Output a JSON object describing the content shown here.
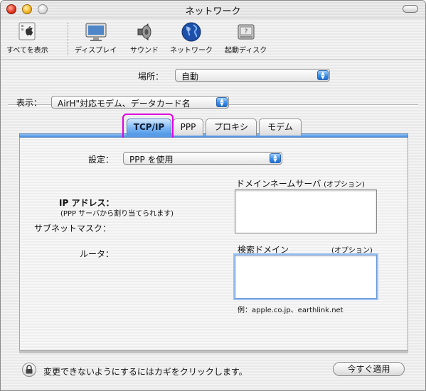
{
  "window": {
    "title": "ネットワーク"
  },
  "toolbar": {
    "items": [
      {
        "label": "すべてを表示",
        "icon": "apple-icon"
      },
      {
        "label": "ディスプレイ",
        "icon": "display-icon"
      },
      {
        "label": "サウンド",
        "icon": "speaker-icon"
      },
      {
        "label": "ネットワーク",
        "icon": "globe-icon"
      },
      {
        "label": "起動ディスク",
        "icon": "disk-icon"
      }
    ]
  },
  "location": {
    "label": "場所：",
    "value": "自動"
  },
  "show": {
    "label": "表示：",
    "value": "AirH\"対応モデム、データカード名"
  },
  "tabs": [
    {
      "label": "TCP/IP",
      "active": true
    },
    {
      "label": "PPP",
      "active": false
    },
    {
      "label": "プロキシ",
      "active": false
    },
    {
      "label": "モデム",
      "active": false
    }
  ],
  "tcpip": {
    "configure_label": "設定：",
    "configure_value": "PPP を使用",
    "dns_label": "ドメインネームサーバ",
    "dns_optional": "(オプション)",
    "ip_label": "IP アドレス：",
    "ip_note": "(PPP サーバから割り当てられます)",
    "subnet_label": "サブネットマスク：",
    "router_label": "ルータ：",
    "search_label": "検索ドメイン",
    "search_optional": "(オプション)",
    "example": "例：apple.co.jp、earthlink.net"
  },
  "footer": {
    "lock_text": "変更できないようにするにはカギをクリックします。",
    "apply_label": "今すぐ適用"
  },
  "colors": {
    "accent": "#4a8fe0",
    "highlight": "#e000e0"
  }
}
